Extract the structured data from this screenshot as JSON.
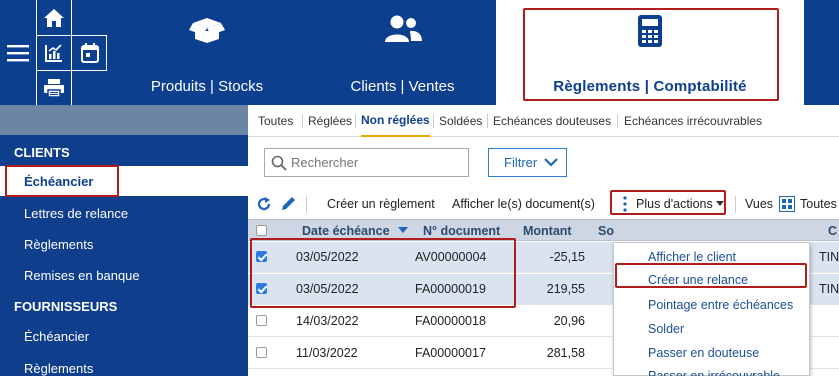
{
  "top": {
    "sections": [
      {
        "label": "Produits | Stocks",
        "icon": "box-open-icon"
      },
      {
        "label": "Clients | Ventes",
        "icon": "users-icon"
      },
      {
        "label": "Règlements | Comptabilité",
        "icon": "calculator-icon"
      }
    ],
    "quick_icons": [
      "menu-icon",
      "home-icon",
      "chart-icon",
      "calendar-icon",
      "print-icon"
    ]
  },
  "sidebar": {
    "clients_header": "CLIENTS",
    "clients_items": [
      "Échéancier",
      "Lettres de relance",
      "Règlements",
      "Remises en banque"
    ],
    "fournisseurs_header": "FOURNISSEURS",
    "fournisseurs_items": [
      "Échéancier",
      "Règlements"
    ]
  },
  "tabs": [
    "Toutes",
    "Réglées",
    "Non réglées",
    "Soldées",
    "Echéances douteuses",
    "Echéances irrécouvrables"
  ],
  "active_tab": "Non réglées",
  "search": {
    "placeholder": "Rechercher"
  },
  "filter_label": "Filtrer",
  "toolbar": {
    "create_payment": "Créer un règlement",
    "show_documents": "Afficher le(s) document(s)",
    "more_actions": "Plus d'actions",
    "views_label": "Vues",
    "views_value": "Toutes"
  },
  "grid": {
    "headers": {
      "date": "Date échéance",
      "doc": "N° document",
      "amount": "Montant",
      "so": "So",
      "c": "C"
    },
    "rows": [
      {
        "checked": true,
        "date": "03/05/2022",
        "doc": "AV00000004",
        "amount": "-25,15",
        "right": "TIN"
      },
      {
        "checked": true,
        "date": "03/05/2022",
        "doc": "FA00000019",
        "amount": "219,55",
        "right": "TIN"
      },
      {
        "checked": false,
        "date": "14/03/2022",
        "doc": "FA00000018",
        "amount": "20,96",
        "right": ""
      },
      {
        "checked": false,
        "date": "11/03/2022",
        "doc": "FA00000017",
        "amount": "281,58",
        "right": ""
      }
    ]
  },
  "dropdown": {
    "items": [
      "Afficher le client",
      "Créer une relance",
      "Pointage entre échéances",
      "Solder",
      "Passer en douteuse",
      "Passer en irrécouvrable"
    ]
  },
  "colors": {
    "brand": "#0d3f8f",
    "highlight": "#b11c1c",
    "accent": "#f0a800"
  }
}
